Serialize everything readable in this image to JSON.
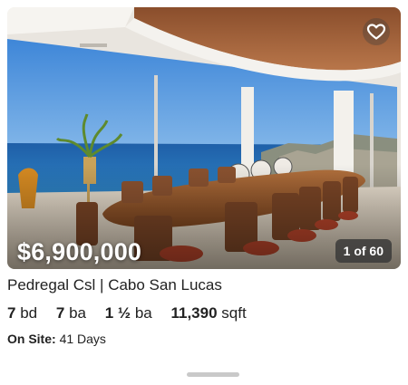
{
  "listing": {
    "price": "$6,900,000",
    "photo_counter": "1 of 60",
    "address": "Pedregal Csl | Cabo San Lucas",
    "beds": {
      "value": "7",
      "unit": "bd"
    },
    "baths": {
      "value": "7",
      "unit": "ba"
    },
    "half_baths": {
      "value": "1 ½",
      "unit": "ba"
    },
    "area": {
      "value": "11,390",
      "unit": "sqft"
    },
    "on_site": {
      "label": "On Site:",
      "value": "41 Days"
    }
  },
  "icons": {
    "favorite": "heart-outline-icon"
  },
  "colors": {
    "counter_bg": "#373737",
    "handle": "#c9c9c9",
    "text": "#222222"
  }
}
